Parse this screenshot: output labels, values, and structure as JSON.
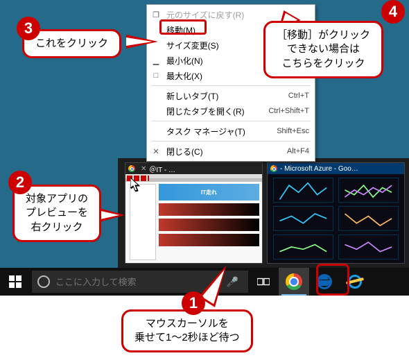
{
  "context_menu": {
    "restore": "元のサイズに戻す(R)",
    "move": "移動(M)",
    "size": "サイズ変更(S)",
    "minimize": "最小化(N)",
    "maximize": "最大化(X)",
    "new_tab": "新しいタブ(T)",
    "new_tab_key": "Ctrl+T",
    "reopen_tab": "閉じたタブを開く(R)",
    "reopen_tab_key": "Ctrl+Shift+T",
    "task_manager": "タスク マネージャ(T)",
    "task_manager_key": "Shift+Esc",
    "close": "閉じる(C)",
    "close_key": "Alt+F4"
  },
  "thumbs": {
    "t1_title": "＠IT - …",
    "t2_title": "- Microsoft Azure - Goo…",
    "banner": "IT走れ"
  },
  "taskbar": {
    "search_placeholder": "ここに入力して検索"
  },
  "callouts": {
    "c1": "マウスカーソルを\n乗せて1～2秒ほど待つ",
    "c2": "対象アプリの\nプレビューを\n右クリック",
    "c3": "これをクリック",
    "c4": "［移動］がクリック\nできない場合は\nこちらをクリック",
    "n1": "1",
    "n2": "2",
    "n3": "3",
    "n4": "4"
  }
}
